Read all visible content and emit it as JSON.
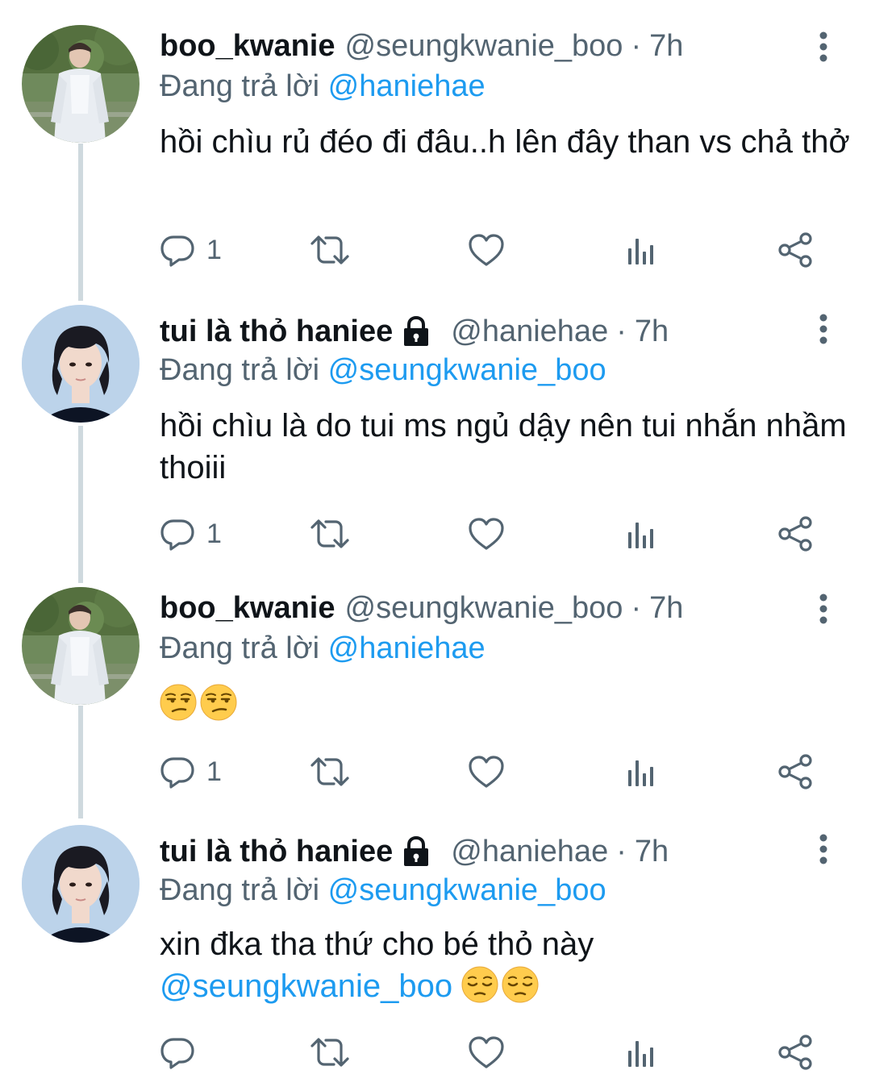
{
  "reply_prefix": "Đang trả lời",
  "tweets": [
    {
      "display_name": "boo_kwanie",
      "handle": "@seungkwanie_boo",
      "time": "7h",
      "protected": false,
      "replying_to": "@haniehae",
      "text": "hồi chìu rủ đéo đi đâu..h lên đây than vs chả thở",
      "mention": "",
      "emoji": [],
      "reply_count": "1",
      "avatar": "man-outdoors-photo"
    },
    {
      "display_name": "tui là thỏ haniee",
      "handle": "@haniehae",
      "time": "7h",
      "protected": true,
      "replying_to": "@seungkwanie_boo",
      "text": "hồi chìu là do tui ms ngủ dậy nên tui nhắn nhầm thoiii",
      "mention": "",
      "emoji": [],
      "reply_count": "1",
      "avatar": "man-portrait-photo"
    },
    {
      "display_name": "boo_kwanie",
      "handle": "@seungkwanie_boo",
      "time": "7h",
      "protected": false,
      "replying_to": "@haniehae",
      "text": "",
      "mention": "",
      "emoji": [
        "unamused-face-emoji",
        "unamused-face-emoji"
      ],
      "reply_count": "1",
      "avatar": "man-outdoors-photo"
    },
    {
      "display_name": "tui là thỏ haniee",
      "handle": "@haniehae",
      "time": "7h",
      "protected": true,
      "replying_to": "@seungkwanie_boo",
      "text": "xin đka tha thứ cho bé thỏ này",
      "mention": "@seungkwanie_boo",
      "emoji": [
        "pensive-face-emoji",
        "pensive-face-emoji"
      ],
      "reply_count": "",
      "avatar": "man-portrait-photo"
    }
  ],
  "colors": {
    "link": "#1d9bf0",
    "secondary_text": "#536471",
    "primary_text": "#0f1419",
    "thread_line": "#cfd9de"
  },
  "icons": [
    "reply-icon",
    "retweet-icon",
    "like-icon",
    "views-icon",
    "share-icon",
    "more-icon",
    "lock-icon"
  ]
}
